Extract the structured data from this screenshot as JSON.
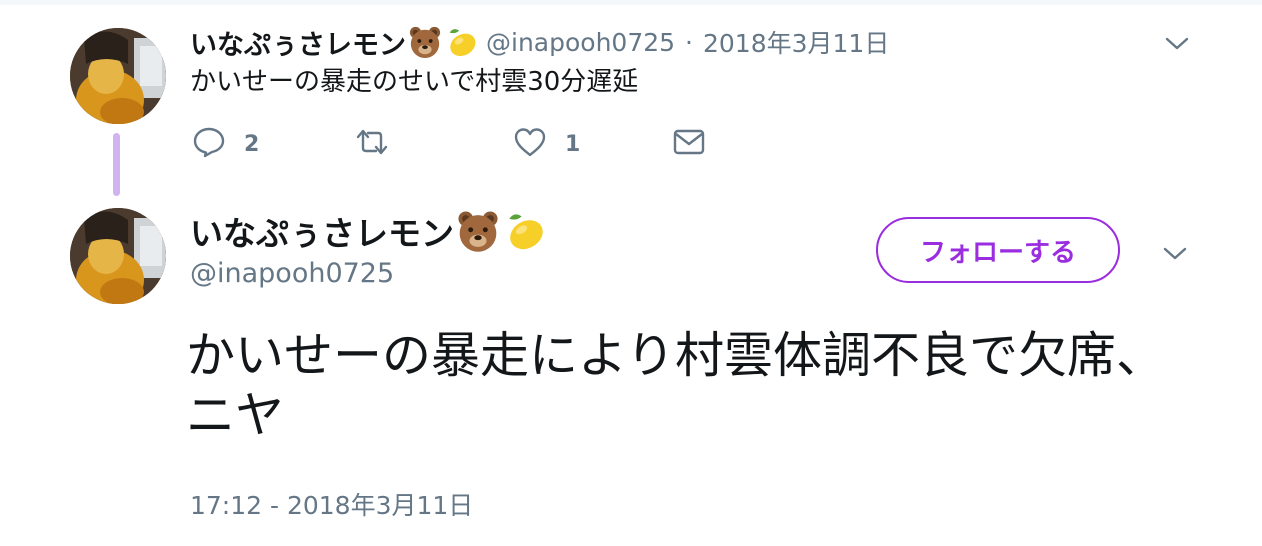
{
  "colors": {
    "accent": "#9b2de0",
    "thread_line": "#d1b3f0",
    "secondary_text": "#657786",
    "primary_text": "#14171a"
  },
  "tweet_reply": {
    "author": {
      "display_name": "いなぷぅさレモン",
      "emojis": [
        "bear-face-icon",
        "lemon-icon"
      ],
      "handle": "@inapooh0725"
    },
    "separator": "·",
    "date": "2018年3月11日",
    "text": "かいせーの暴走のせいで村雲30分遅延",
    "actions": {
      "reply_count": "2",
      "retweet_count": "",
      "like_count": "1"
    }
  },
  "tweet_main": {
    "author": {
      "display_name": "いなぷぅさレモン",
      "emojis": [
        "bear-face-icon",
        "lemon-icon"
      ],
      "handle": "@inapooh0725"
    },
    "follow_label": "フォローする",
    "text": "かいせーの暴走により村雲体調不良で欠席、ニヤ",
    "timestamp": "17:12 - 2018年3月11日"
  }
}
